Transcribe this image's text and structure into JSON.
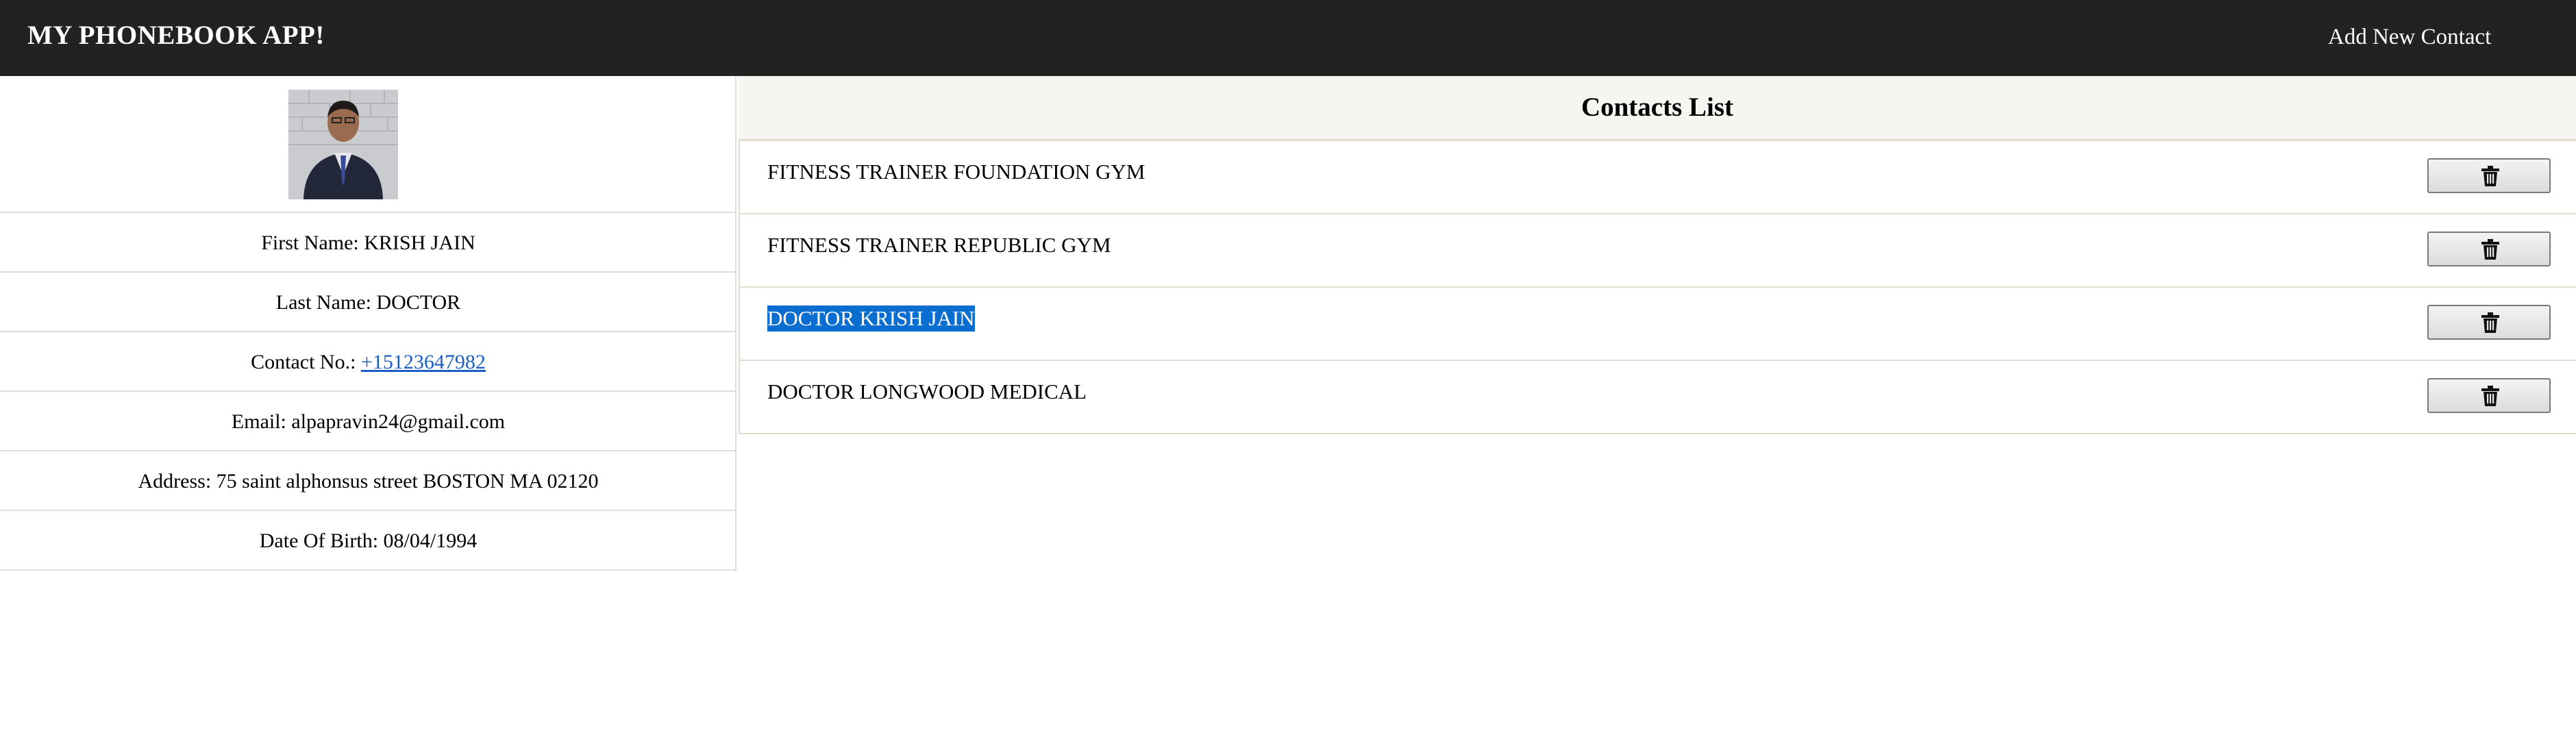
{
  "navbar": {
    "brand": "MY PHONEBOOK APP!",
    "add_link": "Add New Contact"
  },
  "details": {
    "first_name": "First Name: KRISH JAIN",
    "last_name": "Last Name: DOCTOR",
    "contact_label": "Contact No.: ",
    "contact_number": "+15123647982",
    "email": "Email: alpapravin24@gmail.com",
    "address": "Address: 75 saint alphonsus street BOSTON MA 02120",
    "dob": "Date Of Birth: 08/04/1994"
  },
  "contacts": {
    "title": "Contacts List",
    "items": [
      {
        "name": "FITNESS TRAINER FOUNDATION GYM"
      },
      {
        "name": "FITNESS TRAINER REPUBLIC GYM"
      },
      {
        "name": "DOCTOR KRISH JAIN"
      },
      {
        "name": "DOCTOR LONGWOOD MEDICAL"
      }
    ]
  },
  "icons": {
    "delete": "trash-icon"
  },
  "colors": {
    "navbar_bg": "#222222",
    "header_bg": "#f7f5f0",
    "selection": "#0a6ed1",
    "link": "#1a5fc4"
  }
}
